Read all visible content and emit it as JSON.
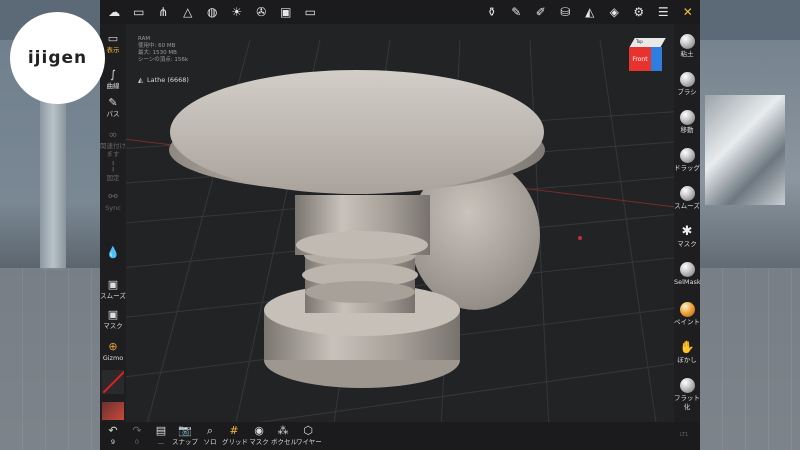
{
  "logo": {
    "text": "ijigen"
  },
  "scene_info": {
    "lines": [
      "RAM",
      "使用中: 60 MB",
      "最大: 1530 MB",
      "シーンの頂点: 156k"
    ]
  },
  "layer": {
    "icon": "mesh-icon",
    "label": "Lathe (6668)"
  },
  "nav_cube": {
    "front_label": "Front",
    "top_label": "Top",
    "colors": {
      "front": "#e8322e",
      "right": "#2f7de0",
      "top": "#e9e9e9"
    }
  },
  "top_toolbar": {
    "left_icons": [
      "nomad-logo-icon",
      "folder-icon",
      "scene-graph-icon",
      "mesh-icon",
      "material-sphere-icon",
      "sun-icon",
      "camera-aperture-icon",
      "image-icon",
      "video-icon"
    ],
    "right_icons": [
      "vase-icon",
      "pencil-icon",
      "eyedropper-icon",
      "paint-bucket-icon",
      "triangle-icon",
      "layers-icon",
      "settings-icon",
      "sliders-icon",
      "tools-icon"
    ]
  },
  "left_toolbar": {
    "items": [
      {
        "icon": "camera-icon",
        "label": "表示"
      },
      {
        "icon": "curve-icon",
        "label": "曲線"
      },
      {
        "icon": "path-icon",
        "label": "パス"
      },
      {
        "icon": "link-icon",
        "label": "関連付けます"
      },
      {
        "icon": "line-icon",
        "label": "固定"
      },
      {
        "icon": "sync-icon",
        "label": "Sync"
      },
      {
        "icon": "droplet-icon",
        "label": ""
      },
      {
        "icon": "smooth-icon",
        "label": "スムーズ"
      },
      {
        "icon": "mask-icon",
        "label": "マスク"
      },
      {
        "icon": "gizmo-icon",
        "label": "Gizmo"
      }
    ]
  },
  "right_toolbar": {
    "items": [
      {
        "icon": "clay-icon",
        "label": "粘土"
      },
      {
        "icon": "brush-icon",
        "label": "ブラシ"
      },
      {
        "icon": "move-icon",
        "label": "移動"
      },
      {
        "icon": "drag-icon",
        "label": "ドラッグ"
      },
      {
        "icon": "smooth-icon",
        "label": "スムーズ"
      },
      {
        "icon": "mask-icon",
        "label": "マスク"
      },
      {
        "icon": "selmask-icon",
        "label": "SelMask"
      },
      {
        "icon": "paint-icon",
        "label": "ペイント"
      },
      {
        "icon": "blur-icon",
        "label": "ぼかし"
      },
      {
        "icon": "flatten-icon",
        "label": "フラット化"
      }
    ]
  },
  "bottom_toolbar": {
    "items": [
      {
        "icon": "undo-icon",
        "label": "9"
      },
      {
        "icon": "redo-icon",
        "label": "0"
      },
      {
        "icon": "layer-stack-icon",
        "label": "..."
      },
      {
        "icon": "snapshot-icon",
        "label": "スナップ"
      },
      {
        "icon": "solo-icon",
        "label": "ソロ"
      },
      {
        "icon": "grid-icon",
        "label": "グリッド"
      },
      {
        "icon": "eye-mask-icon",
        "label": "マスク"
      },
      {
        "icon": "voxel-icon",
        "label": "ボクセル"
      },
      {
        "icon": "wireframe-icon",
        "label": "ワイヤー"
      }
    ]
  },
  "fps": "LT1",
  "colors": {
    "accent": "#f0b93a",
    "background": "#222325",
    "toolbar": "#1b1b1d",
    "mesh": "#b9b2aa"
  }
}
